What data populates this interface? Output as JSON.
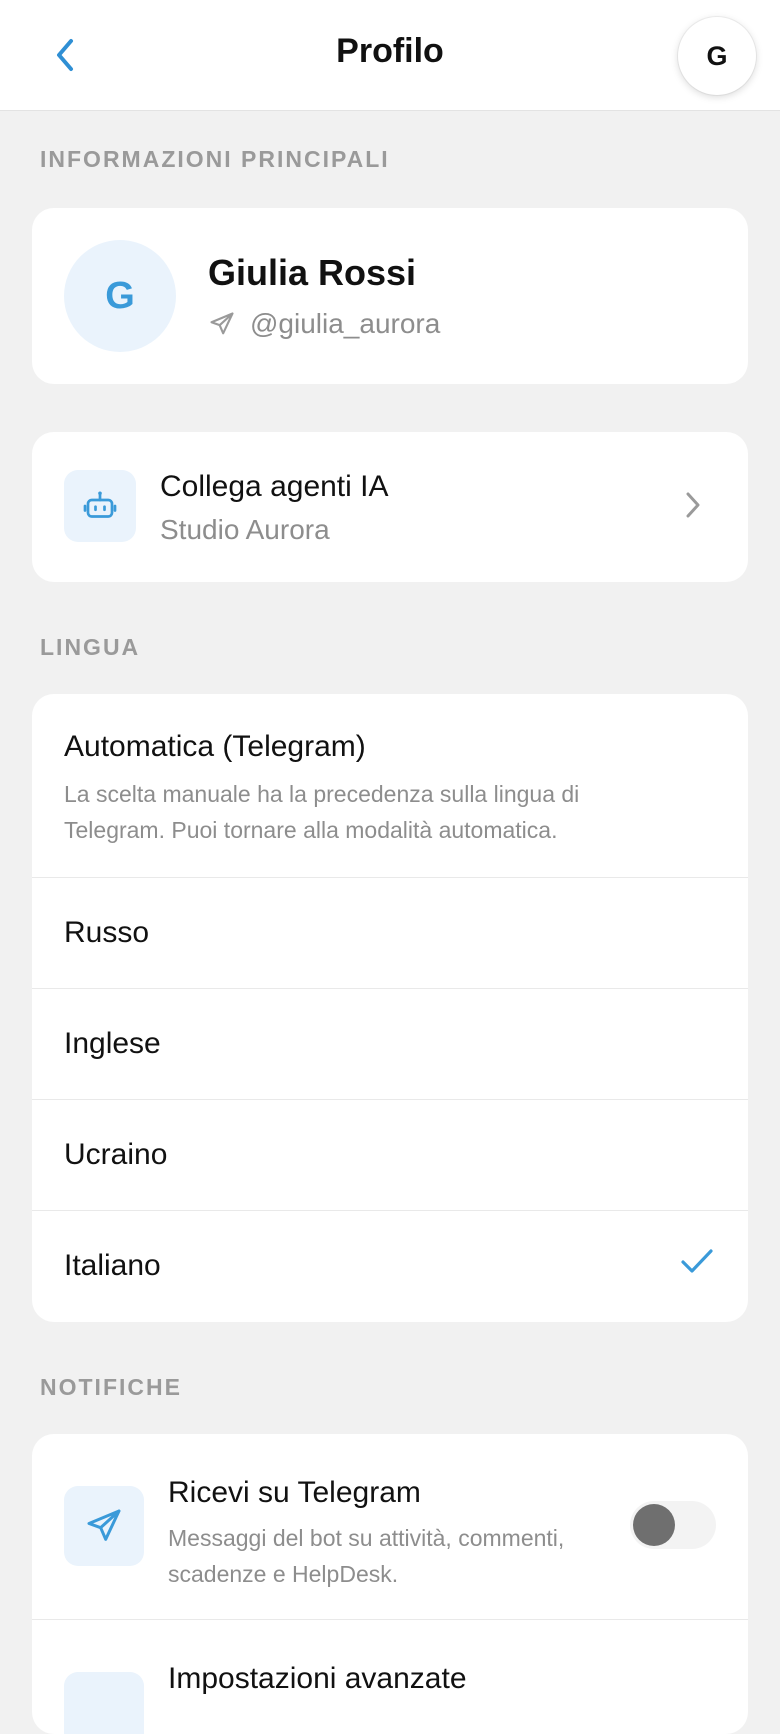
{
  "header": {
    "title": "Profilo",
    "avatar_initial": "G"
  },
  "sections": {
    "main_info": "INFORMAZIONI PRINCIPALI",
    "language": "LINGUA",
    "notifications": "NOTIFICHE"
  },
  "profile": {
    "initial": "G",
    "name": "Giulia Rossi",
    "handle": "@giulia_aurora"
  },
  "agents": {
    "title": "Collega agenti IA",
    "subtitle": "Studio Aurora"
  },
  "language": {
    "auto_title": "Automatica (Telegram)",
    "auto_description": "La scelta manuale ha la precedenza sulla lingua di Telegram. Puoi tornare alla modalità automatica.",
    "options": [
      {
        "label": "Russo",
        "selected": false
      },
      {
        "label": "Inglese",
        "selected": false
      },
      {
        "label": "Ucraino",
        "selected": false
      },
      {
        "label": "Italiano",
        "selected": true
      }
    ]
  },
  "notifications": {
    "telegram_title": "Ricevi su Telegram",
    "telegram_description": "Messaggi del bot su attività, commenti, scadenze e HelpDesk.",
    "telegram_enabled": false,
    "advanced_title": "Impostazioni avanzate"
  },
  "colors": {
    "accent": "#3a9ad9",
    "icon_bg": "#eaf3fc",
    "background": "#f1f1f1",
    "secondary_text": "#8d8d8d"
  },
  "icons": {
    "back": "chevron-left-icon",
    "handle": "telegram-send-icon",
    "agent": "robot-icon",
    "chevron": "chevron-right-icon",
    "check": "checkmark-icon",
    "telegram": "telegram-send-icon"
  }
}
